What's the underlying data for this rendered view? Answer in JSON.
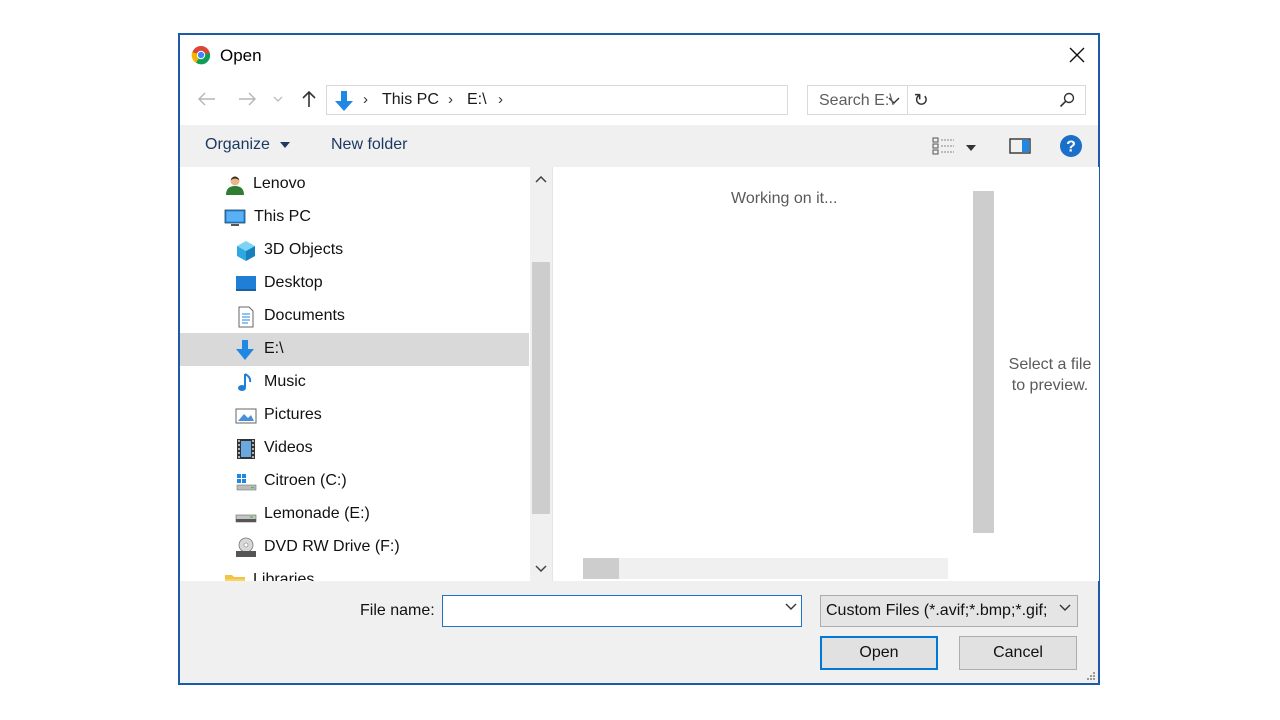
{
  "window": {
    "title": "Open"
  },
  "address": {
    "breadcrumbs": [
      "This PC",
      "E:\\"
    ],
    "search_placeholder": "Search E:\\"
  },
  "toolbar": {
    "organize": "Organize",
    "new_folder": "New folder"
  },
  "nav": {
    "items": [
      {
        "label": "Lenovo",
        "icon": "user-icon"
      },
      {
        "label": "This PC",
        "icon": "pc-icon"
      },
      {
        "label": "3D Objects",
        "icon": "3d-objects-icon"
      },
      {
        "label": "Desktop",
        "icon": "desktop-icon"
      },
      {
        "label": "Documents",
        "icon": "documents-icon"
      },
      {
        "label": "E:\\",
        "icon": "download-arrow-icon",
        "selected": true
      },
      {
        "label": "Music",
        "icon": "music-note-icon"
      },
      {
        "label": "Pictures",
        "icon": "pictures-icon"
      },
      {
        "label": "Videos",
        "icon": "videos-icon"
      },
      {
        "label": "Citroen (C:)",
        "icon": "windows-drive-icon"
      },
      {
        "label": "Lemonade (E:)",
        "icon": "drive-icon"
      },
      {
        "label": "DVD RW Drive (F:)",
        "icon": "dvd-drive-icon"
      },
      {
        "label": "Libraries",
        "icon": "folder-icon"
      }
    ]
  },
  "content": {
    "status": "Working on it...",
    "preview_line1": "Select a file",
    "preview_line2": "to preview."
  },
  "bottom": {
    "file_name_label": "File name:",
    "file_name_value": "",
    "filter": "Custom Files (*.avif;*.bmp;*.gif;",
    "open": "Open",
    "cancel": "Cancel"
  },
  "colors": {
    "accent": "#0078d7",
    "border": "#1d5aa8",
    "selected": "#d9d9d9"
  }
}
